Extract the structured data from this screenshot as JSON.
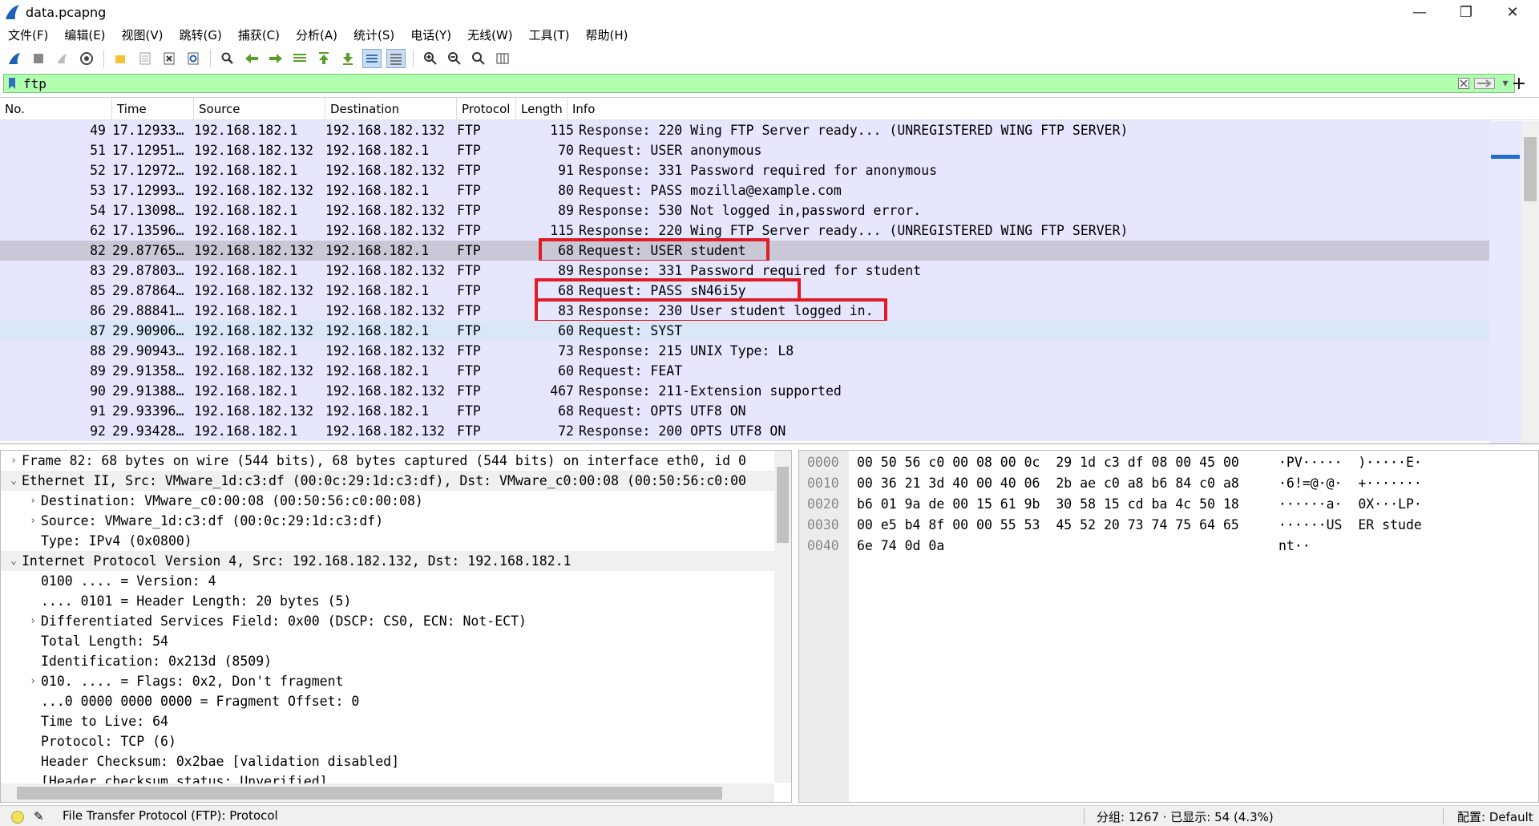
{
  "window": {
    "title": "data.pcapng"
  },
  "menu": [
    "文件(F)",
    "编辑(E)",
    "视图(V)",
    "跳转(G)",
    "捕获(C)",
    "分析(A)",
    "统计(S)",
    "电话(Y)",
    "无线(W)",
    "工具(T)",
    "帮助(H)"
  ],
  "toolbar": {
    "icons": [
      "shark-fin-start-icon",
      "stop-icon",
      "restart-icon",
      "capture-options-icon",
      "open-folder-icon",
      "save-file-icon",
      "close-file-icon",
      "reload-icon",
      "find-icon",
      "go-back-icon",
      "go-forward-icon",
      "go-to-packet-icon",
      "go-first-icon",
      "go-last-icon",
      "autoscroll-icon",
      "colorize-icon",
      "zoom-in-icon",
      "zoom-out-icon",
      "zoom-normal-icon",
      "resize-columns-icon"
    ]
  },
  "filter": {
    "value": "ftp"
  },
  "packet_list": {
    "columns": [
      "No.",
      "Time",
      "Source",
      "Destination",
      "Protocol",
      "Length",
      "Info"
    ],
    "rows": [
      {
        "no": "49",
        "time": "17.12933…",
        "src": "192.168.182.1",
        "dst": "192.168.182.132",
        "proto": "FTP",
        "len": "115",
        "info": "Response: 220 Wing FTP Server ready... (UNREGISTERED WING FTP SERVER)"
      },
      {
        "no": "51",
        "time": "17.12951…",
        "src": "192.168.182.132",
        "dst": "192.168.182.1",
        "proto": "FTP",
        "len": "70",
        "info": "Request: USER anonymous"
      },
      {
        "no": "52",
        "time": "17.12972…",
        "src": "192.168.182.1",
        "dst": "192.168.182.132",
        "proto": "FTP",
        "len": "91",
        "info": "Response: 331 Password required for anonymous"
      },
      {
        "no": "53",
        "time": "17.12993…",
        "src": "192.168.182.132",
        "dst": "192.168.182.1",
        "proto": "FTP",
        "len": "80",
        "info": "Request: PASS mozilla@example.com"
      },
      {
        "no": "54",
        "time": "17.13098…",
        "src": "192.168.182.1",
        "dst": "192.168.182.132",
        "proto": "FTP",
        "len": "89",
        "info": "Response: 530 Not logged in,password error."
      },
      {
        "no": "62",
        "time": "17.13596…",
        "src": "192.168.182.1",
        "dst": "192.168.182.132",
        "proto": "FTP",
        "len": "115",
        "info": "Response: 220 Wing FTP Server ready... (UNREGISTERED WING FTP SERVER)"
      },
      {
        "no": "82",
        "time": "29.87765…",
        "src": "192.168.182.132",
        "dst": "192.168.182.1",
        "proto": "FTP",
        "len": "68",
        "info": "Request: USER student"
      },
      {
        "no": "83",
        "time": "29.87803…",
        "src": "192.168.182.1",
        "dst": "192.168.182.132",
        "proto": "FTP",
        "len": "89",
        "info": "Response: 331 Password required for student"
      },
      {
        "no": "85",
        "time": "29.87864…",
        "src": "192.168.182.132",
        "dst": "192.168.182.1",
        "proto": "FTP",
        "len": "68",
        "info": "Request: PASS sN46i5y"
      },
      {
        "no": "86",
        "time": "29.88841…",
        "src": "192.168.182.1",
        "dst": "192.168.182.132",
        "proto": "FTP",
        "len": "83",
        "info": "Response: 230 User student logged in."
      },
      {
        "no": "87",
        "time": "29.90906…",
        "src": "192.168.182.132",
        "dst": "192.168.182.1",
        "proto": "FTP",
        "len": "60",
        "info": "Request: SYST"
      },
      {
        "no": "88",
        "time": "29.90943…",
        "src": "192.168.182.1",
        "dst": "192.168.182.132",
        "proto": "FTP",
        "len": "73",
        "info": "Response: 215 UNIX Type: L8"
      },
      {
        "no": "89",
        "time": "29.91358…",
        "src": "192.168.182.132",
        "dst": "192.168.182.1",
        "proto": "FTP",
        "len": "60",
        "info": "Request: FEAT"
      },
      {
        "no": "90",
        "time": "29.91388…",
        "src": "192.168.182.1",
        "dst": "192.168.182.132",
        "proto": "FTP",
        "len": "467",
        "info": "Response: 211-Extension supported"
      },
      {
        "no": "91",
        "time": "29.93396…",
        "src": "192.168.182.132",
        "dst": "192.168.182.1",
        "proto": "FTP",
        "len": "68",
        "info": "Request: OPTS UTF8 ON"
      },
      {
        "no": "92",
        "time": "29.93428…",
        "src": "192.168.182.1",
        "dst": "192.168.182.132",
        "proto": "FTP",
        "len": "72",
        "info": "Response: 200 OPTS UTF8 ON"
      }
    ],
    "selected_no": "82",
    "highlight_color": "#e01b24"
  },
  "details": [
    {
      "indent": 0,
      "twisty": "›",
      "text": "Frame 82: 68 bytes on wire (544 bits), 68 bytes captured (544 bits) on interface eth0, id 0"
    },
    {
      "indent": 0,
      "twisty": "⌄",
      "text": "Ethernet II, Src: VMware_1d:c3:df (00:0c:29:1d:c3:df), Dst: VMware_c0:00:08 (00:50:56:c0:00"
    },
    {
      "indent": 1,
      "twisty": "›",
      "text": "Destination: VMware_c0:00:08 (00:50:56:c0:00:08)"
    },
    {
      "indent": 1,
      "twisty": "›",
      "text": "Source: VMware_1d:c3:df (00:0c:29:1d:c3:df)"
    },
    {
      "indent": 1,
      "twisty": "",
      "text": "Type: IPv4 (0x0800)"
    },
    {
      "indent": 0,
      "twisty": "⌄",
      "text": "Internet Protocol Version 4, Src: 192.168.182.132, Dst: 192.168.182.1"
    },
    {
      "indent": 1,
      "twisty": "",
      "text": "0100 .... = Version: 4"
    },
    {
      "indent": 1,
      "twisty": "",
      "text": ".... 0101 = Header Length: 20 bytes (5)"
    },
    {
      "indent": 1,
      "twisty": "›",
      "text": "Differentiated Services Field: 0x00 (DSCP: CS0, ECN: Not-ECT)"
    },
    {
      "indent": 1,
      "twisty": "",
      "text": "Total Length: 54"
    },
    {
      "indent": 1,
      "twisty": "",
      "text": "Identification: 0x213d (8509)"
    },
    {
      "indent": 1,
      "twisty": "›",
      "text": "010. .... = Flags: 0x2, Don't fragment"
    },
    {
      "indent": 1,
      "twisty": "",
      "text": "...0 0000 0000 0000 = Fragment Offset: 0"
    },
    {
      "indent": 1,
      "twisty": "",
      "text": "Time to Live: 64"
    },
    {
      "indent": 1,
      "twisty": "",
      "text": "Protocol: TCP (6)"
    },
    {
      "indent": 1,
      "twisty": "",
      "text": "Header Checksum: 0x2bae [validation disabled]"
    },
    {
      "indent": 1,
      "twisty": "",
      "text": "[Header checksum status: Unverified]"
    }
  ],
  "bytes": [
    {
      "offset": "0000",
      "hex": "00 50 56 c0 00 08 00 0c  29 1d c3 df 08 00 45 00",
      "ascii": "·PV·····  )·····E·"
    },
    {
      "offset": "0010",
      "hex": "00 36 21 3d 40 00 40 06  2b ae c0 a8 b6 84 c0 a8",
      "ascii": "·6!=@·@·  +·······"
    },
    {
      "offset": "0020",
      "hex": "b6 01 9a de 00 15 61 9b  30 58 15 cd ba 4c 50 18",
      "ascii": "······a·  0X···LP·"
    },
    {
      "offset": "0030",
      "hex": "00 e5 b4 8f 00 00 55 53  45 52 20 73 74 75 64 65",
      "ascii": "······US  ER stude"
    },
    {
      "offset": "0040",
      "hex": "6e 74 0d 0a",
      "ascii": "nt··"
    }
  ],
  "status": {
    "text": "File Transfer Protocol (FTP): Protocol",
    "counts": "分组: 1267 · 已显示: 54 (4.3%)",
    "profile": "配置: Default"
  }
}
